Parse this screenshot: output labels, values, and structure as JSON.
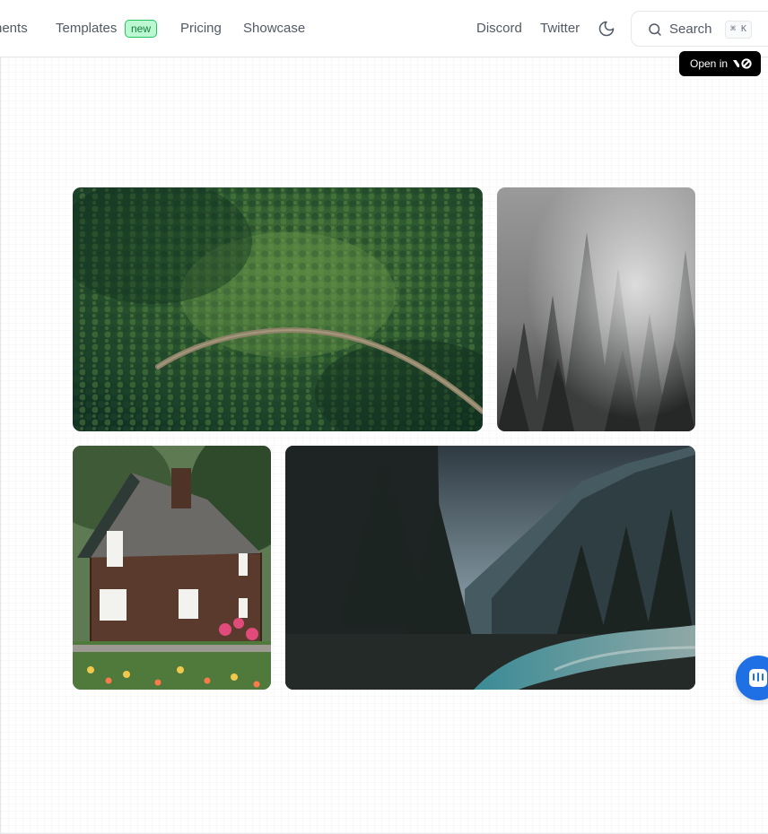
{
  "header": {
    "nav": {
      "components": "nents",
      "templates": "Templates",
      "templates_badge": "new",
      "pricing": "Pricing",
      "showcase": "Showcase",
      "discord": "Discord",
      "twitter": "Twitter"
    },
    "theme_icon": "moon-icon",
    "search": {
      "label": "Search",
      "shortcut": "⌘ K",
      "icon": "search-icon"
    }
  },
  "preview": {
    "open_in_label": "Open in",
    "open_in_logo": "v0-logo",
    "tiles": [
      {
        "name": "aerial-forest-road-image",
        "alt": "Aerial view of a forest with a winding road"
      },
      {
        "name": "misty-forest-image",
        "alt": "Misty pine forest"
      },
      {
        "name": "stone-cottage-image",
        "alt": "Stone cottage with flower garden"
      },
      {
        "name": "mountain-river-image",
        "alt": "Mountain river valley under stormy sky"
      }
    ]
  },
  "chat_launcher": {
    "icon": "chat-icon"
  },
  "colors": {
    "badge_bg": "#bbf7d0",
    "badge_border": "#22c55e",
    "badge_text": "#15803d",
    "chat_blue": "#1f6fe5",
    "nav_text": "#525966"
  }
}
